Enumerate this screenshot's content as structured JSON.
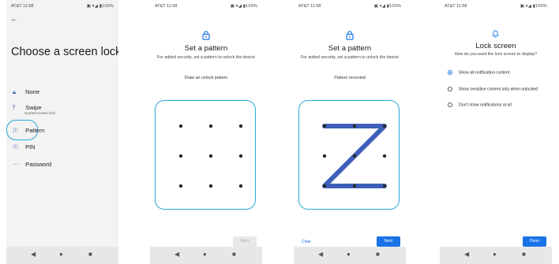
{
  "status": {
    "carrier_time": "AT&T 11:58",
    "icons": "▣ ▾◢ ▮100%"
  },
  "nav": {
    "back": "◀",
    "home": "●",
    "recents": "■"
  },
  "panel1": {
    "title": "Choose a screen lock",
    "options": [
      {
        "label": "None",
        "icon": "lock-icon",
        "glyph": "🔒︎"
      },
      {
        "label": "Swipe",
        "sub": "Current screen lock",
        "icon": "swipe-icon",
        "glyph": "⤒"
      },
      {
        "label": "Pattern",
        "icon": "pattern-grid-icon",
        "glyph": "⁝⁝⁝"
      },
      {
        "label": "PIN",
        "icon": "pin-grid-icon",
        "glyph": "⁝⁝⁝"
      },
      {
        "label": "Password",
        "icon": "password-dots-icon",
        "glyph": "⋯"
      }
    ]
  },
  "panel2": {
    "heading": "Set a pattern",
    "subtext": "For added security, set a pattern to unlock the device",
    "status": "Draw an unlock pattern",
    "next": "Next"
  },
  "panel3": {
    "heading": "Set a pattern",
    "subtext": "For added security, set a pattern to unlock the device",
    "status": "Pattern recorded",
    "clear": "Clear",
    "next": "Next"
  },
  "panel4": {
    "heading": "Lock screen",
    "subtext": "How do you want the lock screen to display?",
    "options": [
      {
        "label": "Show all notification content",
        "selected": true
      },
      {
        "label": "Show sensitive content only when unlocked",
        "selected": false
      },
      {
        "label": "Don't show notifications at all",
        "selected": false
      }
    ],
    "done": "Done"
  },
  "colors": {
    "accent": "#1a73e8",
    "highlight": "#2aa8d9",
    "pattern_line": "#3c5fb8"
  }
}
